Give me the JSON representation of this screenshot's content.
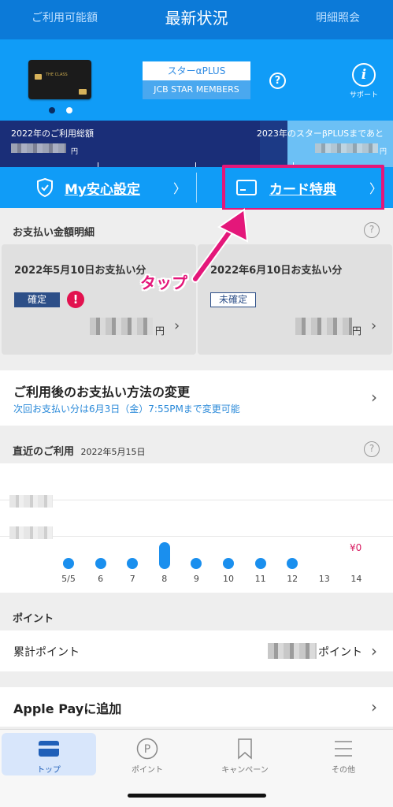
{
  "header": {
    "left_tab": "ご利用可能額",
    "title": "最新状況",
    "right_tab": "明細照会"
  },
  "card": {
    "card_face_text": "THE CLASS",
    "plan_name": "スターαPLUS",
    "program": "JCB STAR MEMBERS",
    "help_icon": "?",
    "support_label": "サポート",
    "support_icon": "i"
  },
  "summary": {
    "left_label": "2022年のご利用総額",
    "left_unit": "円",
    "right_label": "2023年のスターβPLUSまであと",
    "right_unit": "円"
  },
  "quick_actions": {
    "security_label": "My安心設定",
    "benefits_label": "カード特典",
    "chevron": "〉"
  },
  "annotation": {
    "tap_label": "タップ",
    "color": "#e4177a"
  },
  "payment_details": {
    "title": "お支払い金額明細",
    "help_icon": "?",
    "cards": [
      {
        "date": "2022年5月10日お支払い分",
        "status": "確定",
        "alert": "!",
        "unit": "円"
      },
      {
        "date": "2022年6月10日お支払い分",
        "status": "未確定",
        "unit": "円"
      }
    ]
  },
  "payment_change": {
    "title": "ご利用後のお支払い方法の変更",
    "note": "次回お支払い分は6月3日（金）7:55PMまで変更可能"
  },
  "recent_usage": {
    "title": "直近のご利用",
    "date": "2022年5月15日",
    "help_icon": "?",
    "amount_label": "¥0",
    "days": [
      "5/5",
      "6",
      "7",
      "8",
      "9",
      "10",
      "11",
      "12",
      "13",
      "14"
    ]
  },
  "points": {
    "section_title": "ポイント",
    "label": "累計ポイント",
    "unit": "ポイント"
  },
  "apple_pay": {
    "label": "Apple Payに追加"
  },
  "bottom_nav": {
    "items": [
      {
        "label": "トップ",
        "active": true
      },
      {
        "label": "ポイント",
        "icon_text": "P"
      },
      {
        "label": "キャンペーン"
      },
      {
        "label": "その他"
      }
    ]
  },
  "colors": {
    "header_blue": "#0c7ad8",
    "accent_blue": "#109cf7",
    "navy": "#1a2e78",
    "highlight_pink": "#e4177a",
    "alert_red": "#e2124f"
  }
}
